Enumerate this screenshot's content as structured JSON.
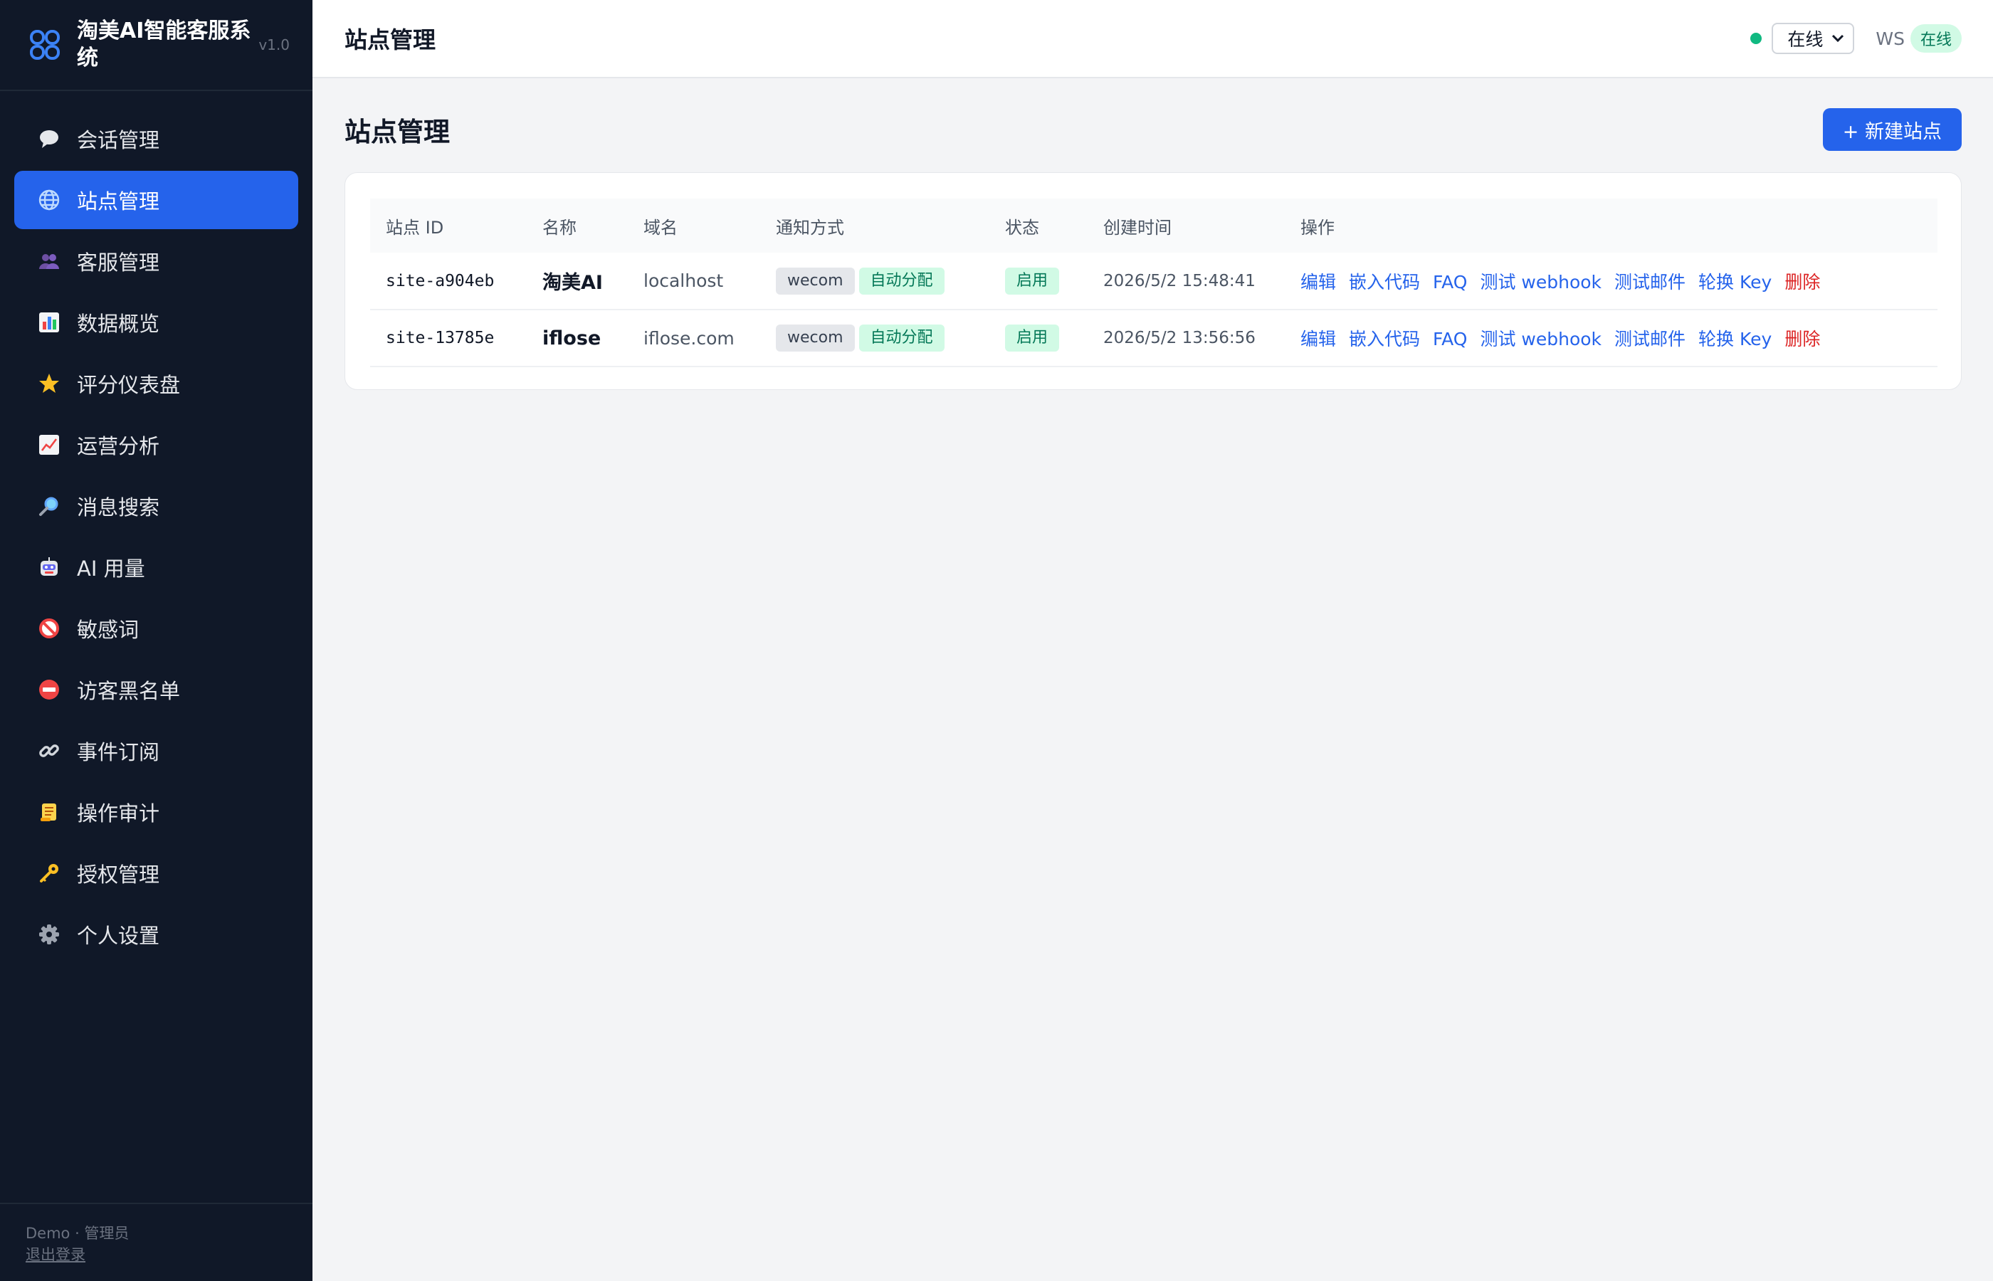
{
  "brand": {
    "title": "淘美AI智能客服系统",
    "version": "v1.0",
    "accent": "#2563eb"
  },
  "sidebar": {
    "items": [
      {
        "label": "会话管理",
        "icon": "speech-bubble-icon",
        "active": false
      },
      {
        "label": "站点管理",
        "icon": "globe-icon",
        "active": true
      },
      {
        "label": "客服管理",
        "icon": "users-icon",
        "active": false
      },
      {
        "label": "数据概览",
        "icon": "bar-chart-icon",
        "active": false
      },
      {
        "label": "评分仪表盘",
        "icon": "star-icon",
        "active": false
      },
      {
        "label": "运营分析",
        "icon": "trend-chart-icon",
        "active": false
      },
      {
        "label": "消息搜索",
        "icon": "magnifier-icon",
        "active": false
      },
      {
        "label": "AI 用量",
        "icon": "robot-icon",
        "active": false
      },
      {
        "label": "敏感词",
        "icon": "prohibited-icon",
        "active": false
      },
      {
        "label": "访客黑名单",
        "icon": "no-entry-icon",
        "active": false
      },
      {
        "label": "事件订阅",
        "icon": "link-icon",
        "active": false
      },
      {
        "label": "操作审计",
        "icon": "scroll-icon",
        "active": false
      },
      {
        "label": "授权管理",
        "icon": "key-icon",
        "active": false
      },
      {
        "label": "个人设置",
        "icon": "gear-icon",
        "active": false
      }
    ],
    "footer": {
      "user": "Demo · 管理员",
      "logout": "退出登录"
    }
  },
  "header": {
    "title": "站点管理",
    "status_select": "在线",
    "status_color": "#10b981",
    "ws_label": "WS",
    "ws_status": "在线"
  },
  "main": {
    "title": "站点管理",
    "new_button": "+ 新建站点",
    "table": {
      "columns": [
        "站点 ID",
        "名称",
        "域名",
        "通知方式",
        "状态",
        "创建时间",
        "操作"
      ],
      "rows": [
        {
          "id": "site-a904eb",
          "name": "淘美AI",
          "domain": "localhost",
          "notify": "wecom",
          "assign": "自动分配",
          "status": "启用",
          "created": "2026/5/2 15:48:41"
        },
        {
          "id": "site-13785e",
          "name": "iflose",
          "domain": "iflose.com",
          "notify": "wecom",
          "assign": "自动分配",
          "status": "启用",
          "created": "2026/5/2 13:56:56"
        }
      ],
      "actions": [
        "编辑",
        "嵌入代码",
        "FAQ",
        "测试 webhook",
        "测试邮件",
        "轮换 Key",
        "删除"
      ]
    }
  }
}
